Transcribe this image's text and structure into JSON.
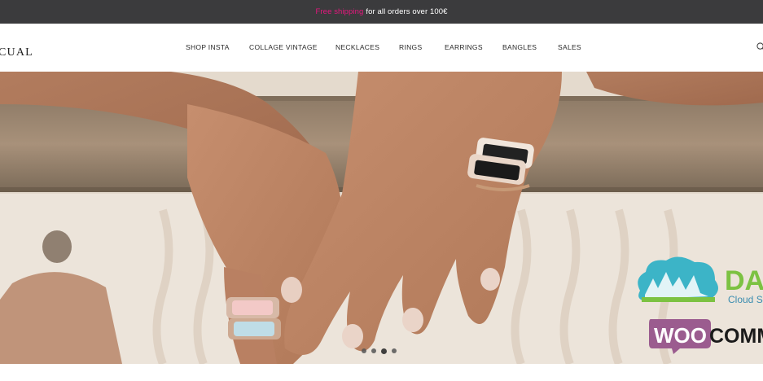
{
  "announcement": {
    "highlight": "Free shipping",
    "text": "for all orders over 100€",
    "highlight_color": "#e5177e"
  },
  "header": {
    "logo": "CUAL",
    "nav": [
      {
        "label": "SHOP INSTA"
      },
      {
        "label": "COLLAGE VINTAGE"
      },
      {
        "label": "NECKLACES"
      },
      {
        "label": "RINGS"
      },
      {
        "label": "EARRINGS"
      },
      {
        "label": "BANGLES"
      },
      {
        "label": "SALES"
      }
    ],
    "search_icon": "search-icon"
  },
  "hero": {
    "description_icon": "hero-photo",
    "slides_total": 4,
    "active_slide": 3
  },
  "watermarks": {
    "dt_text": "DA",
    "dt_sub": "Cloud S",
    "woo_text": "WOO",
    "comm_text": "COMM"
  },
  "colors": {
    "topbar": "#3b3b3d",
    "accent": "#e5177e",
    "woo_purple": "#9b5c8f",
    "dt_green": "#7cc242",
    "dt_teal": "#3cb4c7"
  }
}
